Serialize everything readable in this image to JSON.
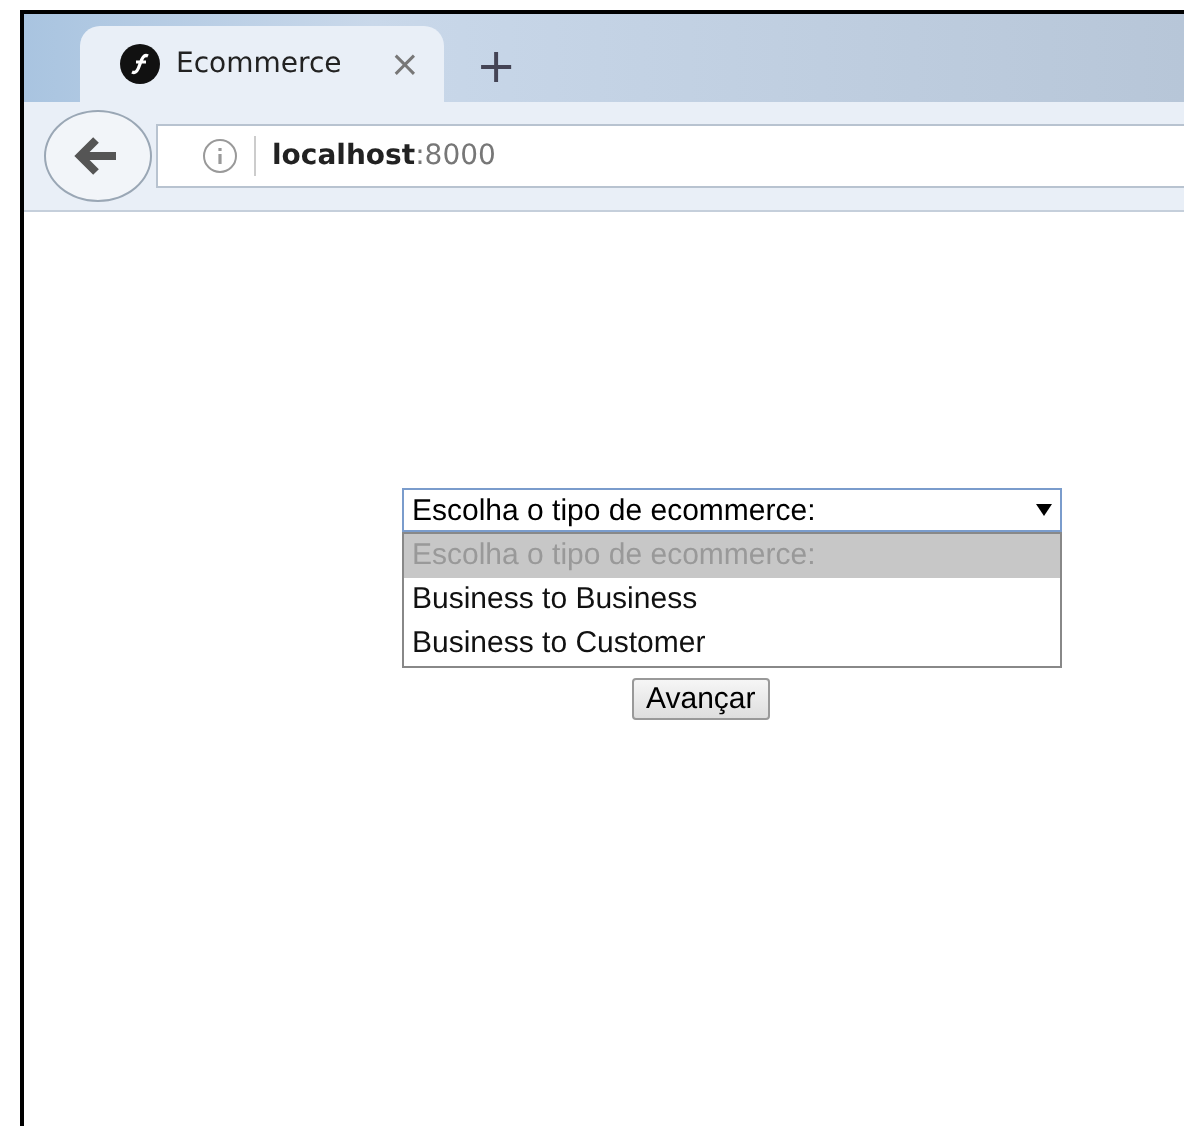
{
  "browser": {
    "tab": {
      "title": "Ecommerce",
      "selected": true
    },
    "new_tab": "+",
    "close_tab": "×",
    "address": {
      "host": "localhost",
      "port": ":8000"
    }
  },
  "form": {
    "select": {
      "value": "Escolha o tipo de ecommerce:",
      "expanded": true,
      "options": [
        {
          "label": "Escolha o tipo de ecommerce:",
          "disabled": true,
          "selected": true
        },
        {
          "label": "Business to Business",
          "disabled": false,
          "selected": false
        },
        {
          "label": "Business to Customer",
          "disabled": false,
          "selected": false
        }
      ]
    },
    "button": "Avançar"
  }
}
